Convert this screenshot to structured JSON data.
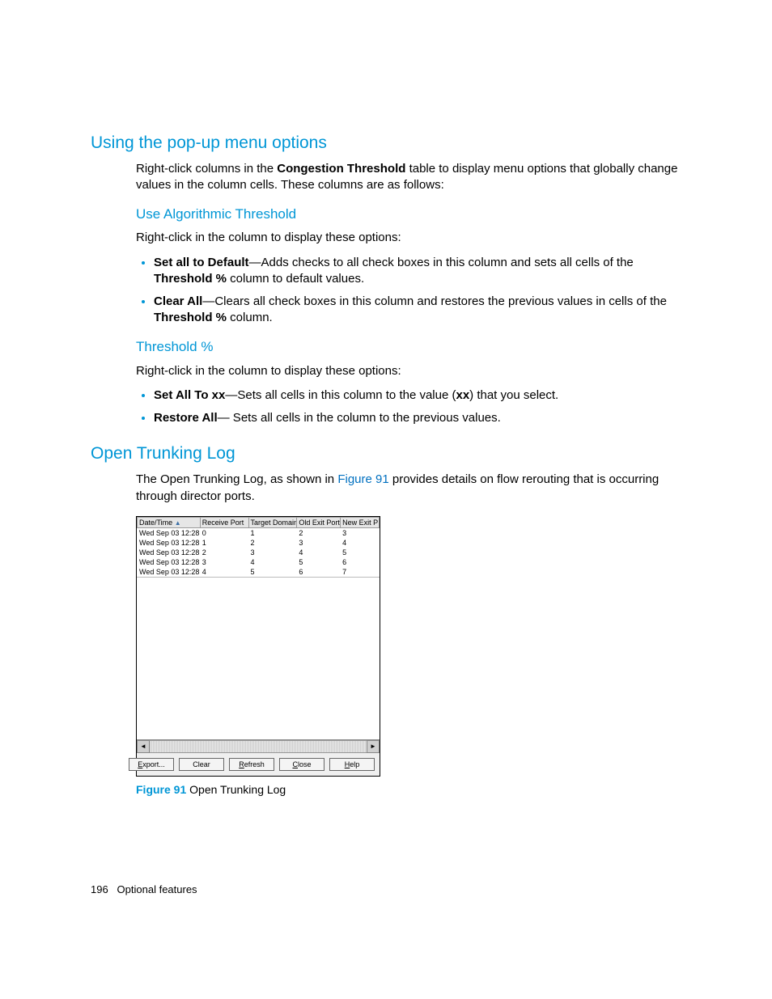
{
  "headings": {
    "popup": "Using the pop-up menu options",
    "use_alg": "Use Algorithmic Threshold",
    "threshold_pct": "Threshold %",
    "open_trunk": "Open Trunking Log"
  },
  "paragraphs": {
    "popup_intro_1": "Right-click columns in the ",
    "popup_intro_bold": "Congestion Threshold",
    "popup_intro_2": " table to display menu options that globally change values in the column cells. These columns are as follows:",
    "alg_intro": "Right-click in the column to display these options:",
    "thresh_intro": "Right-click in the column to display these options:",
    "trunk_intro_1": "The Open Trunking Log, as shown in ",
    "trunk_link": "Figure 91",
    "trunk_intro_2": " provides details on flow rerouting that is occurring through director ports."
  },
  "bullets_alg": {
    "b1_term": "Set all to Default",
    "b1_text_1": "—Adds checks to all check boxes in this column and sets all cells of the ",
    "b1_bold": "Threshold %",
    "b1_text_2": " column to default values.",
    "b2_term": "Clear All",
    "b2_text_1": "—Clears all check boxes in this column and restores the previous values in cells of the ",
    "b2_bold": "Threshold %",
    "b2_text_2": " column."
  },
  "bullets_thresh": {
    "b1_term": "Set All To xx",
    "b1_text_1": "—Sets all cells in this column to the value (",
    "b1_bold": "xx",
    "b1_text_2": ") that you select.",
    "b2_term": "Restore All",
    "b2_text": "— Sets all cells in the column to the previous values."
  },
  "figure": {
    "label": "Figure 91",
    "caption": " Open Trunking Log"
  },
  "dialog": {
    "columns": {
      "c1": "Date/Time",
      "c2": "Receive Port",
      "c3": "Target Domain",
      "c4": "Old Exit Port",
      "c5": "New Exit P"
    },
    "rows": [
      {
        "dt": "Wed Sep 03 12:28...",
        "rp": "0",
        "td": "1",
        "oe": "2",
        "ne": "3"
      },
      {
        "dt": "Wed Sep 03 12:28...",
        "rp": "1",
        "td": "2",
        "oe": "3",
        "ne": "4"
      },
      {
        "dt": "Wed Sep 03 12:28...",
        "rp": "2",
        "td": "3",
        "oe": "4",
        "ne": "5"
      },
      {
        "dt": "Wed Sep 03 12:28...",
        "rp": "3",
        "td": "4",
        "oe": "5",
        "ne": "6"
      },
      {
        "dt": "Wed Sep 03 12:28...",
        "rp": "4",
        "td": "5",
        "oe": "6",
        "ne": "7"
      }
    ],
    "buttons": {
      "export": "Export...",
      "clear": "Clear",
      "refresh": "Refresh",
      "close": "Close",
      "help": "Help"
    }
  },
  "footer": {
    "page": "196",
    "section": "Optional features"
  },
  "chart_data": {
    "type": "table",
    "title": "Open Trunking Log",
    "columns": [
      "Date/Time",
      "Receive Port",
      "Target Domain",
      "Old Exit Port",
      "New Exit Port"
    ],
    "rows": [
      [
        "Wed Sep 03 12:28...",
        0,
        1,
        2,
        3
      ],
      [
        "Wed Sep 03 12:28...",
        1,
        2,
        3,
        4
      ],
      [
        "Wed Sep 03 12:28...",
        2,
        3,
        4,
        5
      ],
      [
        "Wed Sep 03 12:28...",
        3,
        4,
        5,
        6
      ],
      [
        "Wed Sep 03 12:28...",
        4,
        5,
        6,
        7
      ]
    ]
  }
}
